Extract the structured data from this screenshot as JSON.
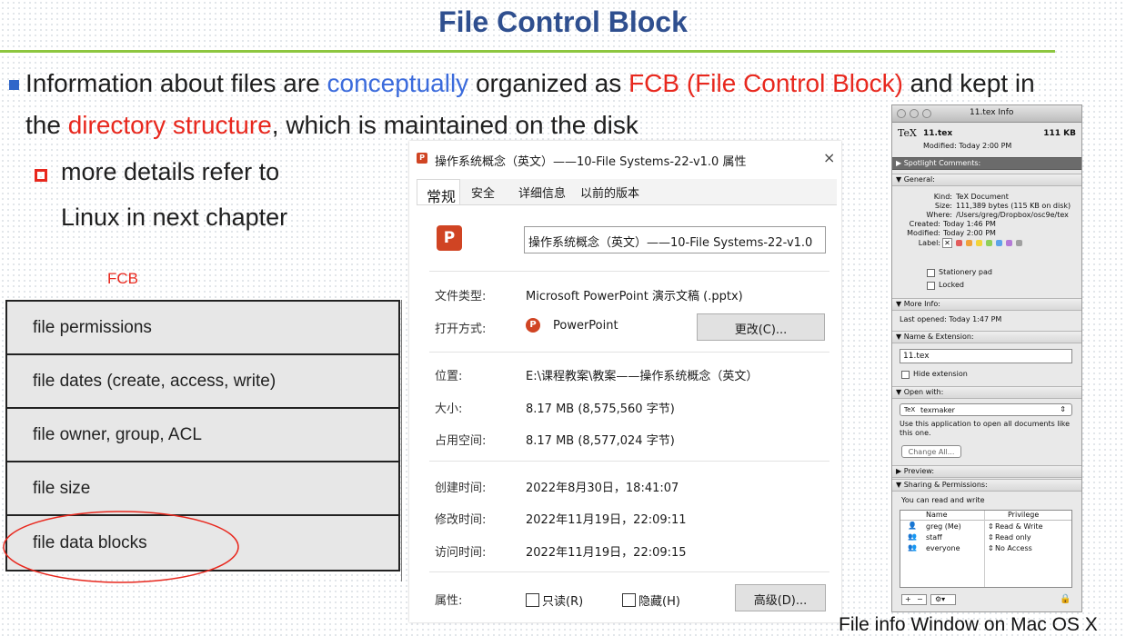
{
  "slide": {
    "title": "File Control Block",
    "bullet1": {
      "p1": "Information about files are ",
      "p2": "conceptually",
      "p3": " organized as ",
      "p4": "FCB (File Control Block)",
      "p5": " and kept in",
      "p6": "the ",
      "p7": "directory structure",
      "p8": ", which is maintained on the disk"
    },
    "sub_bullet": {
      "line1": "more details refer to",
      "line2": "Linux in next chapter"
    },
    "fcb_label": "FCB",
    "fcb_rows": [
      "file permissions",
      "file dates (create, access, write)",
      "file owner, group, ACL",
      "file size",
      "file data blocks"
    ],
    "caption": "File info Window on Mac OS X"
  },
  "win": {
    "title": "操作系统概念（英文）——10-File Systems-22-v1.0 属性",
    "close": "×",
    "tabs": [
      "常规",
      "安全",
      "详细信息",
      "以前的版本"
    ],
    "file_name": "操作系统概念（英文）——10-File Systems-22-v1.0",
    "file_type_label": "文件类型:",
    "file_type": "Microsoft PowerPoint 演示文稿 (.pptx)",
    "open_with_label": "打开方式:",
    "open_with": "PowerPoint",
    "change_btn": "更改(C)...",
    "location_label": "位置:",
    "location": "E:\\课程教案\\教案——操作系统概念（英文）",
    "size_label": "大小:",
    "size": "8.17 MB (8,575,560 字节)",
    "disk_label": "占用空间:",
    "disk": "8.17 MB (8,577,024 字节)",
    "created_label": "创建时间:",
    "created": "2022年8月30日，18:41:07",
    "modified_label": "修改时间:",
    "modified": "2022年11月19日，22:09:11",
    "accessed_label": "访问时间:",
    "accessed": "2022年11月19日，22:09:15",
    "attr_label": "属性:",
    "readonly": "只读(R)",
    "hidden": "隐藏(H)",
    "advanced_btn": "高级(D)..."
  },
  "mac": {
    "window_title": "11.tex Info",
    "file_name": "11.tex",
    "file_size": "111 KB",
    "modified_line": "Modified: Today 2:00 PM",
    "spotlight": "Spotlight Comments:",
    "general": "General:",
    "kind_label": "Kind:",
    "kind": "TeX Document",
    "size_label": "Size:",
    "size": "111,389 bytes (115 KB on disk)",
    "where_label": "Where:",
    "where": "/Users/greg/Dropbox/osc9e/tex",
    "created_label": "Created:",
    "created": "Today 1:46 PM",
    "modified_label": "Modified:",
    "modified": "Today 2:00 PM",
    "label_label": "Label:",
    "stationery": "Stationery pad",
    "locked": "Locked",
    "more_info": "More Info:",
    "last_opened": "Last opened: Today 1:47 PM",
    "name_ext": "Name & Extension:",
    "name_value": "11.tex",
    "hide_ext": "Hide extension",
    "open_with": "Open with:",
    "app": "texmaker",
    "use_app": "Use this application to open all documents like this one.",
    "change_all": "Change All...",
    "preview": "Preview:",
    "sharing": "Sharing & Permissions:",
    "read_write_note": "You can read and write",
    "col_name": "Name",
    "col_priv": "Privilege",
    "perm_rows": [
      {
        "name": "greg (Me)",
        "priv": "Read & Write"
      },
      {
        "name": "staff",
        "priv": "Read only"
      },
      {
        "name": "everyone",
        "priv": "No Access"
      }
    ],
    "label_colors": [
      "#e25c5c",
      "#f0a23b",
      "#f2d43a",
      "#8fcf5a",
      "#5ea3ea",
      "#b47ad6",
      "#a0a0a0"
    ]
  }
}
